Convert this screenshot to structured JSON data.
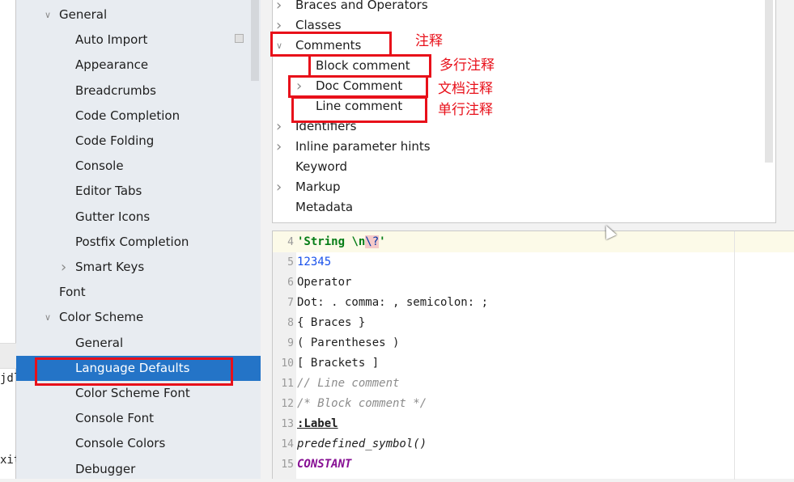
{
  "left_strip": {
    "code_lines": [
      "jdl",
      "xit"
    ]
  },
  "sidebar": {
    "items": [
      {
        "label": "General",
        "level": 1,
        "expanded": true
      },
      {
        "label": "Auto Import",
        "level": 2
      },
      {
        "label": "Appearance",
        "level": 2
      },
      {
        "label": "Breadcrumbs",
        "level": 2
      },
      {
        "label": "Code Completion",
        "level": 2
      },
      {
        "label": "Code Folding",
        "level": 2
      },
      {
        "label": "Console",
        "level": 2
      },
      {
        "label": "Editor Tabs",
        "level": 2
      },
      {
        "label": "Gutter Icons",
        "level": 2
      },
      {
        "label": "Postfix Completion",
        "level": 2
      },
      {
        "label": "Smart Keys",
        "level": 2,
        "collapsed": true
      },
      {
        "label": "Font",
        "level": 1
      },
      {
        "label": "Color Scheme",
        "level": 1,
        "expanded": true
      },
      {
        "label": "General",
        "level": 2
      },
      {
        "label": "Language Defaults",
        "level": 2,
        "selected": true
      },
      {
        "label": "Color Scheme Font",
        "level": 2
      },
      {
        "label": "Console Font",
        "level": 2
      },
      {
        "label": "Console Colors",
        "level": 2
      },
      {
        "label": "Debugger",
        "level": 2
      }
    ]
  },
  "tree": {
    "items": [
      {
        "label": "Braces and Operators",
        "arrow": "collapsed",
        "level": 0
      },
      {
        "label": "Classes",
        "arrow": "collapsed",
        "level": 0
      },
      {
        "label": "Comments",
        "arrow": "expanded",
        "level": 0
      },
      {
        "label": "Block comment",
        "arrow": "none",
        "level": 1
      },
      {
        "label": "Doc Comment",
        "arrow": "collapsed",
        "level": 1
      },
      {
        "label": "Line comment",
        "arrow": "none",
        "level": 1
      },
      {
        "label": "Identifiers",
        "arrow": "collapsed",
        "level": 0
      },
      {
        "label": "Inline parameter hints",
        "arrow": "collapsed",
        "level": 0
      },
      {
        "label": "Keyword",
        "arrow": "none",
        "level": 0
      },
      {
        "label": "Markup",
        "arrow": "collapsed",
        "level": 0
      },
      {
        "label": "Metadata",
        "arrow": "none",
        "level": 0
      }
    ]
  },
  "annotations": {
    "comments": "注释",
    "block": "多行注释",
    "doc": "文档注释",
    "line": "单行注释",
    "color": "#e8101a"
  },
  "editor": {
    "lines": [
      {
        "n": "4",
        "parts": [
          {
            "t": "'String ",
            "c": "str"
          },
          {
            "t": "\\n",
            "c": "str"
          },
          {
            "t": "\\?",
            "c": "esc"
          },
          {
            "t": "'",
            "c": "str"
          }
        ]
      },
      {
        "n": "5",
        "parts": [
          {
            "t": "12345",
            "c": "num"
          }
        ]
      },
      {
        "n": "6",
        "parts": [
          {
            "t": "Operator",
            "c": ""
          }
        ]
      },
      {
        "n": "7",
        "parts": [
          {
            "t": "Dot: . comma: , semicolon: ;",
            "c": ""
          }
        ]
      },
      {
        "n": "8",
        "parts": [
          {
            "t": "{ Braces }",
            "c": ""
          }
        ]
      },
      {
        "n": "9",
        "parts": [
          {
            "t": "( Parentheses )",
            "c": ""
          }
        ]
      },
      {
        "n": "10",
        "parts": [
          {
            "t": "[ Brackets ]",
            "c": ""
          }
        ]
      },
      {
        "n": "11",
        "parts": [
          {
            "t": "// Line comment",
            "c": "cmt"
          }
        ]
      },
      {
        "n": "12",
        "parts": [
          {
            "t": "/* Block comment */",
            "c": "cmt"
          }
        ]
      },
      {
        "n": "13",
        "parts": [
          {
            "t": ":Label",
            "c": "lbl"
          }
        ]
      },
      {
        "n": "14",
        "parts": [
          {
            "t": "predefined_symbol()",
            "c": "pre"
          }
        ]
      },
      {
        "n": "15",
        "parts": [
          {
            "t": "CONSTANT",
            "c": "const"
          }
        ]
      }
    ]
  },
  "colors": {
    "selection": "#2474c7",
    "sidebar_bg": "#e8ecf1",
    "highlight_box": "#e8101a"
  }
}
